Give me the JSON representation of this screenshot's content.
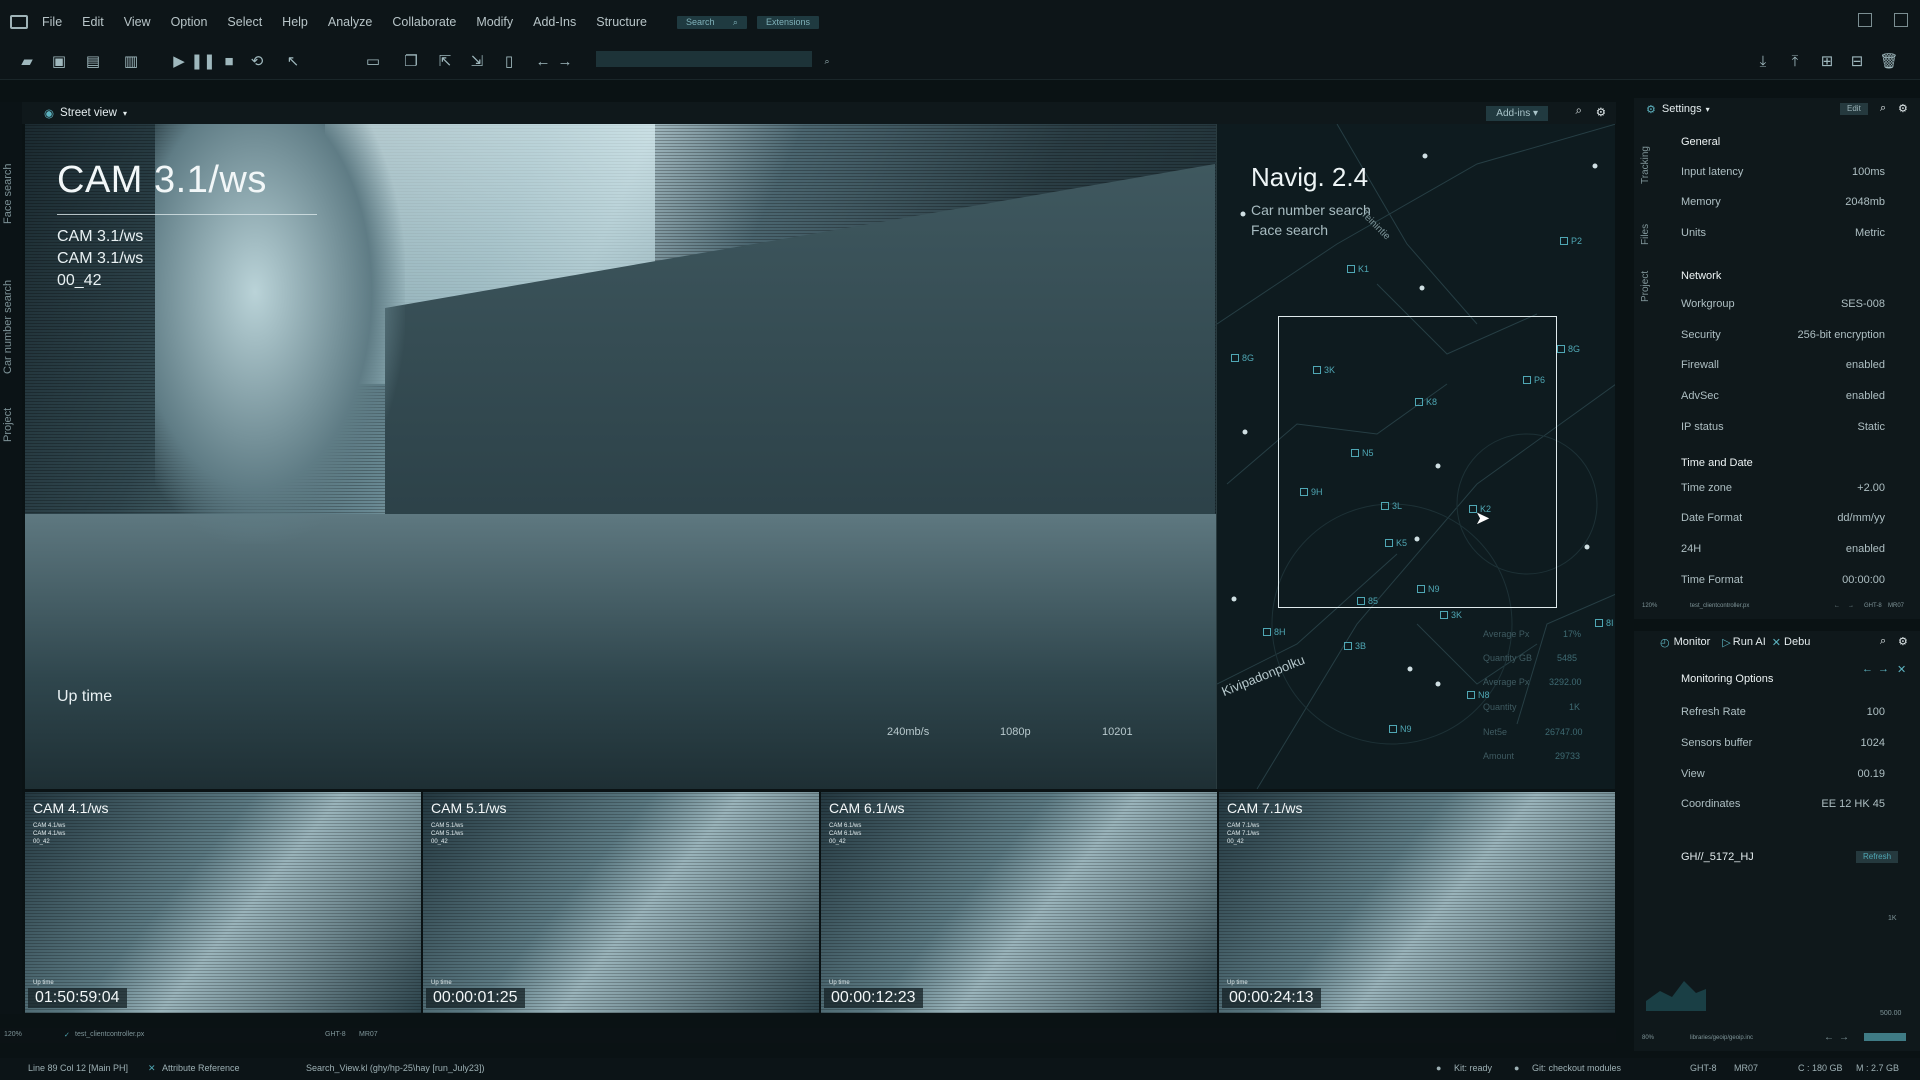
{
  "menubar": {
    "items": [
      "File",
      "Edit",
      "View",
      "Option",
      "Select",
      "Help",
      "Analyze",
      "Collaborate",
      "Modify",
      "Add-Ins",
      "Structure"
    ],
    "search_label": "Search",
    "extensions_label": "Extensions"
  },
  "view": {
    "title": "Street view",
    "addins_label": "Add-ins"
  },
  "left_tabs": [
    "Face search",
    "Car number search",
    "Project"
  ],
  "main_camera": {
    "title": "CAM 3.1/ws",
    "lines": [
      "CAM 3.1/ws",
      "CAM 3.1/ws",
      "00_42"
    ],
    "uptime_label": "Up time",
    "stats": [
      "240mb/s",
      "1080p",
      "10201"
    ]
  },
  "nav": {
    "title": "Navig. 2.4",
    "sub1": "Car number search",
    "sub2": "Face search",
    "street1": "Teinintie",
    "street2": "Kivipadonpolku",
    "markers": [
      "K1",
      "P2",
      "8G",
      "8G",
      "3K",
      "K8",
      "P6",
      "N5",
      "9H",
      "3L",
      "K2",
      "K5",
      "N9",
      "85",
      "3K",
      "8H",
      "3B",
      "8I",
      "N8",
      "N9"
    ],
    "stats": [
      {
        "label": "Average Px",
        "value": "17%"
      },
      {
        "label": "Quantity GB",
        "value": "5485"
      },
      {
        "label": "Average Px",
        "value": "3292.00"
      },
      {
        "label": "Quantity",
        "value": "1K"
      },
      {
        "label": "Net5e",
        "value": "26747.00"
      },
      {
        "label": "Amount",
        "value": "29733"
      }
    ]
  },
  "thumbs": [
    {
      "title": "CAM 4.1/ws",
      "sub": [
        "CAM 4.1/ws",
        "CAM 4.1/ws",
        "00_42"
      ],
      "uptime": "Up time",
      "time": "01:50:59:04"
    },
    {
      "title": "CAM 5.1/ws",
      "sub": [
        "CAM 5.1/ws",
        "CAM 5.1/ws",
        "00_42"
      ],
      "uptime": "Up time",
      "time": "00:00:01:25"
    },
    {
      "title": "CAM 6.1/ws",
      "sub": [
        "CAM 6.1/ws",
        "CAM 6.1/ws",
        "00_42"
      ],
      "uptime": "Up time",
      "time": "00:00:12:23"
    },
    {
      "title": "CAM 7.1/ws",
      "sub": [
        "CAM 7.1/ws",
        "CAM 7.1/ws",
        "00_42"
      ],
      "uptime": "Up time",
      "time": "00:00:24:13"
    }
  ],
  "substatus": {
    "zoom": "120%",
    "file": "test_clientcontroller.px",
    "branch": "GHT-8",
    "mr": "MR07"
  },
  "statusbar": {
    "position": "Line 89 Col 12 [Main PH]",
    "attr": "Attribute Reference",
    "path": "Search_View.kl (ghy/hp-25\\hay [run_July23])",
    "kit": "Kit: ready",
    "git": "Git: checkout modules",
    "branch": "GHT-8",
    "mr": "MR07",
    "disk": "C : 180 GB",
    "mem": "M : 2.7 GB"
  },
  "settings": {
    "title": "Settings",
    "edit_label": "Edit",
    "tabs": [
      "Tracking",
      "Files",
      "Project"
    ],
    "general": {
      "heading": "General",
      "rows": [
        {
          "k": "Input latency",
          "v": "100ms"
        },
        {
          "k": "Memory",
          "v": "2048mb"
        },
        {
          "k": "Units",
          "v": "Metric"
        }
      ]
    },
    "network": {
      "heading": "Network",
      "rows": [
        {
          "k": "Workgroup",
          "v": "SES-008"
        },
        {
          "k": "Security",
          "v": "256-bit encryption"
        },
        {
          "k": "Firewall",
          "v": "enabled"
        },
        {
          "k": "AdvSec",
          "v": "enabled"
        },
        {
          "k": "IP status",
          "v": "Static"
        }
      ]
    },
    "time": {
      "heading": "Time and Date",
      "rows": [
        {
          "k": "Time zone",
          "v": "+2.00"
        },
        {
          "k": "Date Format",
          "v": "dd/mm/yy"
        },
        {
          "k": "24H",
          "v": "enabled"
        },
        {
          "k": "Time Format",
          "v": "00:00:00"
        }
      ]
    },
    "footer": {
      "zoom": "120%",
      "file": "test_clientcontroller.px",
      "branch": "GHT-8",
      "mr": "MR07"
    }
  },
  "monitor": {
    "title": "Monitor",
    "run_label": "Run AI",
    "debug_label": "Debu",
    "heading": "Monitoring Options",
    "rows": [
      {
        "k": "Refresh Rate",
        "v": "100"
      },
      {
        "k": "Sensors buffer",
        "v": "1024"
      },
      {
        "k": "View",
        "v": "00.19"
      },
      {
        "k": "Coordinates",
        "v": "EE 12 HK 45"
      }
    ],
    "id": "GH//_5172_HJ",
    "refresh_label": "Refresh",
    "axis_top": "1K",
    "axis_bottom": "500.00",
    "footer": {
      "zoom": "80%",
      "file": "libraries/geoip/geoip.inc"
    }
  },
  "colors": {
    "accent": "#4fa7b4",
    "panel": "#0f181b",
    "bg": "#0a1214"
  }
}
